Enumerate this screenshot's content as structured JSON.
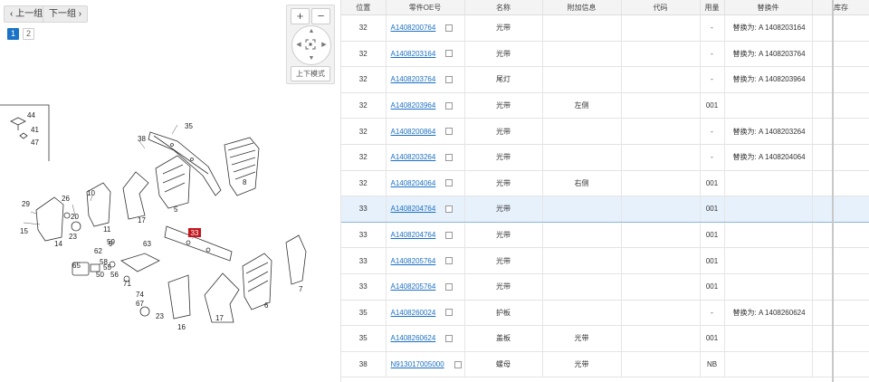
{
  "nav": {
    "prev_label": "上一组",
    "next_label": "下一组"
  },
  "pages": [
    "1",
    "2"
  ],
  "zoom": {
    "in": "+",
    "out": "−",
    "mode_label": "上下模式"
  },
  "diagram": {
    "highlight_label": "33",
    "callouts": [
      "44",
      "41",
      "47",
      "35",
      "38",
      "8",
      "29",
      "26",
      "10",
      "5",
      "15",
      "14",
      "20",
      "23",
      "11",
      "17",
      "9",
      "63",
      "62",
      "59",
      "65",
      "55",
      "50",
      "58",
      "56",
      "71",
      "74",
      "67",
      "23",
      "16",
      "17",
      "6",
      "7"
    ]
  },
  "table": {
    "headers": [
      "位置",
      "零件OE号",
      "名称",
      "附加信息",
      "代码",
      "用量",
      "替换件",
      "库存"
    ],
    "rows": [
      {
        "pos": "32",
        "part": "A1408200764",
        "name": "光带",
        "info": "",
        "code": "",
        "qty": "-",
        "replace": "替换为: A 1408203164",
        "stock": ""
      },
      {
        "pos": "32",
        "part": "A1408203164",
        "name": "光带",
        "info": "",
        "code": "",
        "qty": "-",
        "replace": "替换为: A 1408203764",
        "stock": ""
      },
      {
        "pos": "32",
        "part": "A1408203764",
        "name": "尾灯",
        "info": "",
        "code": "",
        "qty": "-",
        "replace": "替换为: A 1408203964",
        "stock": ""
      },
      {
        "pos": "32",
        "part": "A1408203964",
        "name": "光带",
        "info": "左侧",
        "code": "",
        "qty": "001",
        "replace": "",
        "stock": ""
      },
      {
        "pos": "32",
        "part": "A1408200864",
        "name": "光带",
        "info": "",
        "code": "",
        "qty": "-",
        "replace": "替换为: A 1408203264",
        "stock": ""
      },
      {
        "pos": "32",
        "part": "A1408203264",
        "name": "光带",
        "info": "",
        "code": "",
        "qty": "-",
        "replace": "替换为: A 1408204064",
        "stock": ""
      },
      {
        "pos": "32",
        "part": "A1408204064",
        "name": "光带",
        "info": "右侧",
        "code": "",
        "qty": "001",
        "replace": "",
        "stock": ""
      },
      {
        "pos": "33",
        "part": "A1408204764",
        "name": "光带",
        "info": "",
        "code": "",
        "qty": "001",
        "replace": "",
        "stock": "",
        "selected": true
      },
      {
        "pos": "33",
        "part": "A1408204764",
        "name": "光带",
        "info": "",
        "code": "",
        "qty": "001",
        "replace": "",
        "stock": ""
      },
      {
        "pos": "33",
        "part": "A1408205764",
        "name": "光带",
        "info": "",
        "code": "",
        "qty": "001",
        "replace": "",
        "stock": ""
      },
      {
        "pos": "33",
        "part": "A1408205764",
        "name": "光带",
        "info": "",
        "code": "",
        "qty": "001",
        "replace": "",
        "stock": ""
      },
      {
        "pos": "35",
        "part": "A1408260024",
        "name": "护板",
        "info": "",
        "code": "",
        "qty": "-",
        "replace": "替换为: A 1408260624",
        "stock": ""
      },
      {
        "pos": "35",
        "part": "A1408260624",
        "name": "盖板",
        "info": "光带",
        "code": "",
        "qty": "001",
        "replace": "",
        "stock": ""
      },
      {
        "pos": "38",
        "part": "N913017005000",
        "name": "螺母",
        "info": "光带",
        "code": "",
        "qty": "NB",
        "replace": "",
        "stock": ""
      }
    ]
  },
  "colors": {
    "accent": "#1a73c6",
    "highlight_bg": "#e7f1fb",
    "callout_red": "#c4161c",
    "link": "#1a6fc4"
  }
}
